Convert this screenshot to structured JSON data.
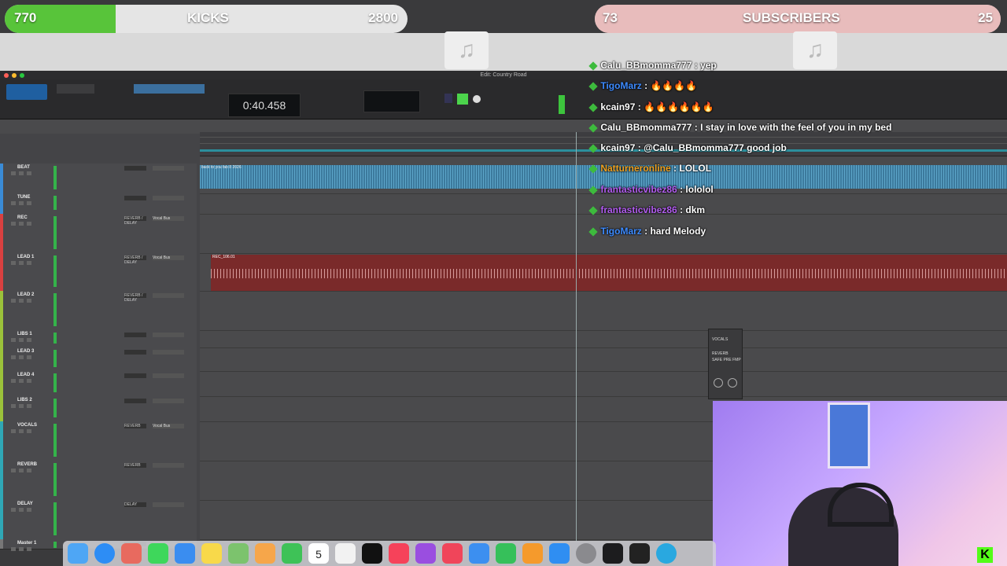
{
  "goals": {
    "left": {
      "current": "770",
      "label": "KICKS",
      "target": "2800",
      "fill_fraction": 0.275
    },
    "right": {
      "current": "73",
      "label": "SUBSCRIBERS",
      "target": "25",
      "fill_fraction": 1.0
    }
  },
  "window": {
    "title": "Edit: Country Road"
  },
  "transport": {
    "counter": "0:40.458"
  },
  "tracks": [
    {
      "name": "BEAT",
      "color": "#3a8bd6",
      "plugin": "",
      "io": "",
      "clip": "back to you fab 8 2026"
    },
    {
      "name": "TUNE",
      "color": "#3a8bd6",
      "plugin": "",
      "io": "",
      "clip": ""
    },
    {
      "name": "REC",
      "color": "#d94040",
      "plugin": "REVERB / DELAY",
      "io": "Vocal Bus",
      "clip": ""
    },
    {
      "name": "LEAD 1",
      "color": "#d94040",
      "plugin": "REVERB / DELAY",
      "io": "Vocal Bus",
      "clip": "REC_106.01"
    },
    {
      "name": "LEAD 2",
      "color": "#9bc23a",
      "plugin": "REVERB / DELAY",
      "io": "",
      "clip": ""
    },
    {
      "name": "LIBS 1",
      "color": "#9bc23a",
      "plugin": "",
      "io": "",
      "clip": ""
    },
    {
      "name": "LEAD 3",
      "color": "#9bc23a",
      "plugin": "",
      "io": "",
      "clip": ""
    },
    {
      "name": "LEAD 4",
      "color": "#9bc23a",
      "plugin": "",
      "io": "",
      "clip": ""
    },
    {
      "name": "LIBS 2",
      "color": "#9bc23a",
      "plugin": "",
      "io": "",
      "clip": ""
    },
    {
      "name": "VOCALS",
      "color": "#2fa7b5",
      "plugin": "REVERB",
      "io": "Vocal Bus",
      "clip": ""
    },
    {
      "name": "REVERB",
      "color": "#2fa7b5",
      "plugin": "REVERB",
      "io": "",
      "clip": ""
    },
    {
      "name": "DELAY",
      "color": "#2fa7b5",
      "plugin": "DELAY",
      "io": "",
      "clip": ""
    },
    {
      "name": "Master 1",
      "color": "#777777",
      "plugin": "",
      "io": "",
      "clip": ""
    }
  ],
  "chat": [
    {
      "user": "Calu_BBmomma777",
      "user_color": "#ffffff",
      "message": "yep"
    },
    {
      "user": "TigoMarz",
      "user_color": "#3d8bff",
      "message": "🔥🔥🔥🔥"
    },
    {
      "user": "kcain97",
      "user_color": "#ffffff",
      "message": "🔥🔥🔥🔥🔥🔥"
    },
    {
      "user": "Calu_BBmomma777",
      "user_color": "#ffffff",
      "message": "I stay in love with the feel of you in my bed"
    },
    {
      "user": "kcain97",
      "user_color": "#ffffff",
      "message": "@Calu_BBmomma777 good job"
    },
    {
      "user": "Natturneronline",
      "user_color": "#f0a020",
      "message": "LOLOL"
    },
    {
      "user": "frantasticvibez86",
      "user_color": "#b25df0",
      "message": "lololol"
    },
    {
      "user": "frantasticvibez86",
      "user_color": "#b25df0",
      "message": "dkm"
    },
    {
      "user": "TigoMarz",
      "user_color": "#3d8bff",
      "message": "hard Melody"
    }
  ],
  "mini_window": {
    "label": "VOCALS",
    "send": "REVERB",
    "buttons": [
      "SAFE",
      "PRE",
      "FMP"
    ]
  },
  "dock": {
    "calendar_day": "5"
  },
  "icons": [
    "music-note-icon",
    "kick-logo-icon",
    "finder-icon",
    "safari-icon",
    "calendar-icon",
    "music-icon",
    "podcasts-icon",
    "app-store-icon"
  ]
}
